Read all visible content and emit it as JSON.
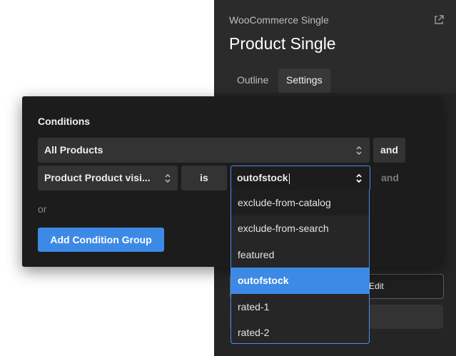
{
  "sidebar": {
    "subtitle": "WooCommerce Single",
    "title": "Product Single",
    "tabs": [
      "Outline",
      "Settings"
    ],
    "active_tab": "Settings",
    "edit_label": "Edit",
    "icons": {
      "external": "external-link-icon"
    }
  },
  "modal": {
    "title": "Conditions",
    "row1": {
      "field": "All Products",
      "conjunction": "and"
    },
    "row2": {
      "field": "Product Product visi...",
      "operator": "is",
      "value": "outofstock",
      "conjunction": "and"
    },
    "or_label": "or",
    "add_group_label": "Add Condition Group"
  },
  "dropdown": {
    "options": [
      "exclude-from-catalog",
      "exclude-from-search",
      "featured",
      "outofstock",
      "rated-1",
      "rated-2"
    ],
    "selected": "outofstock"
  },
  "colors": {
    "accent": "#3d8ae6",
    "panel": "#252525",
    "modal": "#1c1c1c"
  }
}
